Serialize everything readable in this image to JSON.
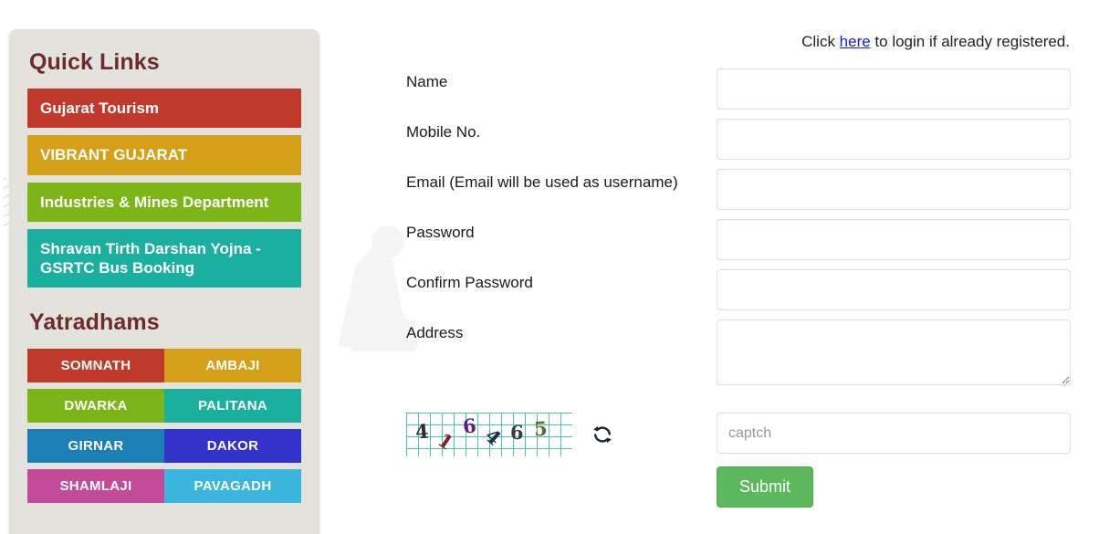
{
  "sidebar": {
    "quick_links_heading": "Quick Links",
    "quick_links": [
      {
        "label": "Gujarat Tourism",
        "color": "#c0392b"
      },
      {
        "label": "VIBRANT GUJARAT",
        "color": "#d4a017"
      },
      {
        "label": "Industries & Mines Department",
        "color": "#7cb518"
      },
      {
        "label": "Shravan Tirth Darshan Yojna - GSRTC Bus Booking",
        "color": "#1aaf9e"
      }
    ],
    "yatradhams_heading": "Yatradhams",
    "yatradhams": [
      {
        "label": "SOMNATH",
        "color": "#c0392b"
      },
      {
        "label": "AMBAJI",
        "color": "#d4a017"
      },
      {
        "label": "DWARKA",
        "color": "#7cb518"
      },
      {
        "label": "PALITANA",
        "color": "#1aaf9e"
      },
      {
        "label": "GIRNAR",
        "color": "#1b7fb5"
      },
      {
        "label": "DAKOR",
        "color": "#3333cc"
      },
      {
        "label": "SHAMLAJI",
        "color": "#c44a9a"
      },
      {
        "label": "PAVAGADH",
        "color": "#3ab5dd"
      }
    ]
  },
  "login_note": {
    "prefix": "Click ",
    "link": "here",
    "suffix": " to login if already registered."
  },
  "form": {
    "fields": [
      {
        "label": "Name",
        "value": "",
        "placeholder": ""
      },
      {
        "label": "Mobile No.",
        "value": "",
        "placeholder": ""
      },
      {
        "label": "Email (Email will be used as username)",
        "value": "",
        "placeholder": ""
      },
      {
        "label": "Password",
        "value": "",
        "placeholder": ""
      },
      {
        "label": "Confirm Password",
        "value": "",
        "placeholder": ""
      },
      {
        "label": "Address",
        "value": "",
        "placeholder": ""
      }
    ]
  },
  "captcha": {
    "digits": [
      "4",
      "1",
      "6",
      "4",
      "6",
      "5"
    ],
    "text": "416465",
    "refresh_icon": "refresh-icon",
    "input_value": "",
    "input_placeholder": "captch"
  },
  "submit": {
    "label": "Submit",
    "color": "#5cb85c"
  }
}
